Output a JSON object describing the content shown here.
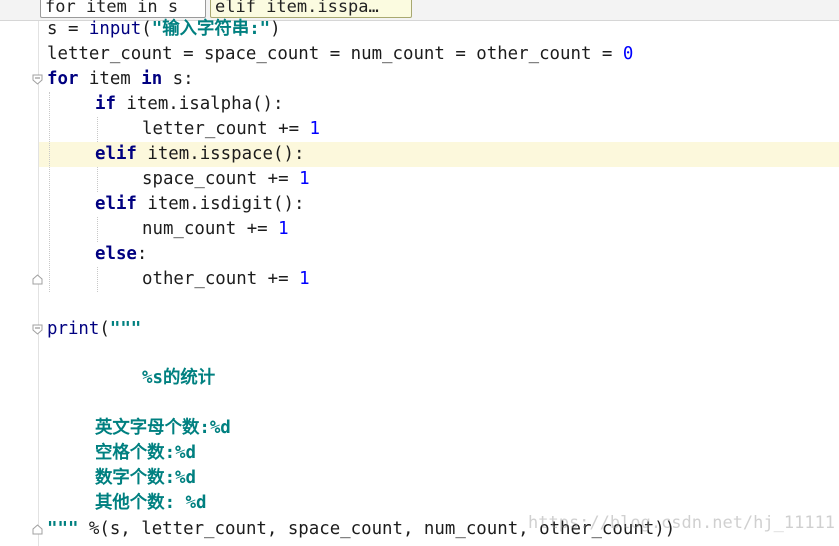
{
  "breadcrumbs": [
    "for item in s",
    "elif item.isspa…"
  ],
  "code": {
    "l1_a": "s = ",
    "l1_b": "input",
    "l1_c": "(",
    "l1_d": "\"",
    "l1_e": "输入字符串",
    "l1_f": ":\"",
    "l1_g": ")",
    "l2_a": "letter_count = space_count = num_count = other_count = ",
    "l2_b": "0",
    "l3_a": "for",
    "l3_b": " item ",
    "l3_c": "in",
    "l3_d": " s:",
    "l4_a": "if",
    "l4_b": " item.isalpha():",
    "l5_a": "letter_count += ",
    "l5_b": "1",
    "l6_a": "elif",
    "l6_b": " item.isspace():",
    "l7_a": "space_count += ",
    "l7_b": "1",
    "l8_a": "elif",
    "l8_b": " item.isdigit():",
    "l9_a": "num_count += ",
    "l9_b": "1",
    "l10_a": "else",
    "l10_b": ":",
    "l11_a": "other_count += ",
    "l11_b": "1",
    "l13_a": "print",
    "l13_b": "(",
    "l13_c": "\"\"\"",
    "l15_a": "%s",
    "l15_b": "的统计",
    "l17_a": "英文字母个数",
    "l17_b": ":%d",
    "l18_a": "空格个数",
    "l18_b": ":%d",
    "l19_a": "数字个数",
    "l19_b": ":%d",
    "l20_a": "其他个数",
    "l20_b": ": %d",
    "l21_a": "\"\"\"",
    "l21_b": " %(s, letter_count, space_count, num_count, other_count))"
  },
  "watermark": "https://blog.csdn.net/hj_11111",
  "colors": {
    "keyword": "#000080",
    "string": "#008080",
    "number": "#0000ff",
    "current_line": "#fcf8dc"
  }
}
